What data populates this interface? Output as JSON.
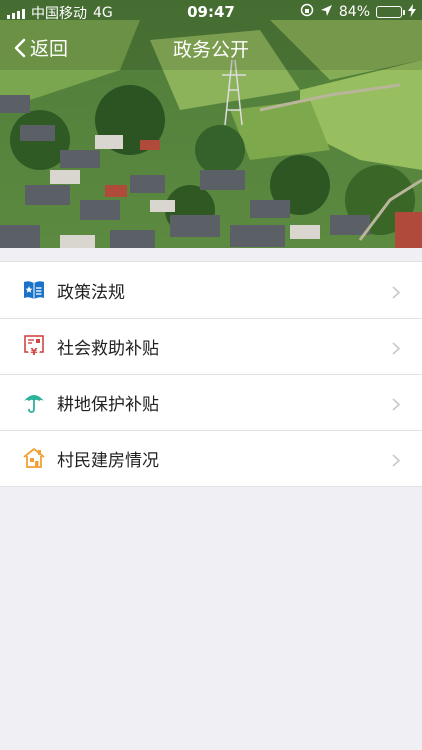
{
  "status_bar": {
    "carrier": "中国移动",
    "network": "4G",
    "time": "09:47",
    "battery_percent": "84%",
    "battery_level": 0.84
  },
  "nav": {
    "back_label": "返回",
    "title": "政务公开"
  },
  "menu": {
    "items": [
      {
        "label": "政策法规",
        "icon": "policy-book-icon",
        "color": "#1a73c8"
      },
      {
        "label": "社会救助补贴",
        "icon": "yuan-document-icon",
        "color": "#d24545"
      },
      {
        "label": "耕地保护补贴",
        "icon": "umbrella-icon",
        "color": "#2bb39b"
      },
      {
        "label": "村民建房情况",
        "icon": "house-icon",
        "color": "#f0a035"
      }
    ]
  }
}
